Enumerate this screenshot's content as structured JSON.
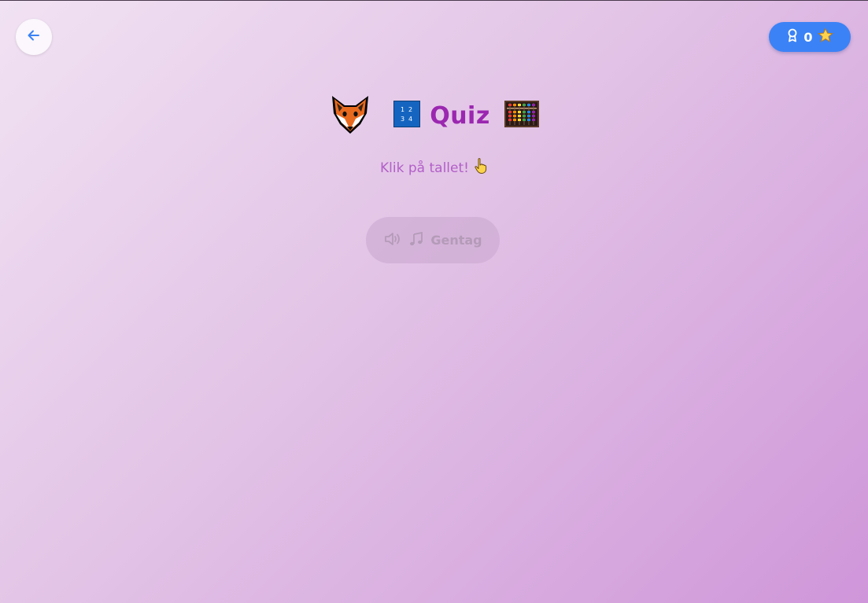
{
  "header": {
    "back_icon": "arrow-left-icon",
    "score": {
      "value": "0",
      "award_icon": "award-icon",
      "star_icon": "star-icon"
    }
  },
  "quiz": {
    "title": "Quiz",
    "title_icons": [
      "fox-icon",
      "number-grid-icon",
      "abacus-icon"
    ],
    "instruction": "Klik på tallet!",
    "instruction_icon": "pointing-hand-icon",
    "repeat_button": {
      "label": "Gentag",
      "icons": [
        "speaker-icon",
        "music-note-icon"
      ],
      "state": "disabled"
    }
  },
  "colors": {
    "accent": "#3b82f6",
    "title": "#9b27b0",
    "instruction": "#b25fc8"
  }
}
